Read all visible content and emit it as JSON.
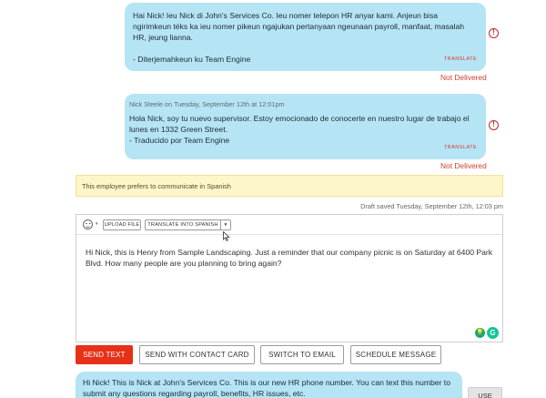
{
  "messages": [
    {
      "meta": "",
      "body": "Hai Nick! Ieu Nick di John's Services Co. Ieu nomer telepon HR anyar kami. Anjeun bisa ngirimkeun téks ka ieu nomer pikeun ngajukan pertanyaan ngeunaan payroll, manfaat, masalah HR, jeung lianna.",
      "footer": "- Diterjemahkeun ku Team Engine",
      "translate_label": "TRANSLATE",
      "status": "Not Delivered"
    },
    {
      "meta": "Nick Steele on Tuesday, September 12th at 12:01pm",
      "body": "Hola Nick, soy tu nuevo supervisor. Estoy emocionado de conocerte en nuestro lugar de trabajo el lunes en 1332 Green Street.",
      "footer": "- Traducido por Team Engine",
      "translate_label": "TRANSLATE",
      "status": "Not Delivered"
    }
  ],
  "alert_icon_name": "exclamation-circle-icon",
  "preference_banner": "This employee prefers to communicate in Spanish",
  "draft_status": "Draft saved Tuesday, September 12th, 12:03 pm",
  "composer": {
    "toolbar": {
      "emoji_icon": "emoji-smile-icon",
      "emoji_caret": "▾",
      "upload_label": "UPLOAD FILE",
      "translate_label": "TRANSLATE INTO SPANISH",
      "translate_caret": "▾"
    },
    "text": "Hi Nick, this is Henry from Sample Landscaping. Just a reminder that our company picnic is on Saturday at 6400 Park Blvd. How many people are you planning to bring again?",
    "grammarly_bulb": "💡",
    "grammarly_logo": "G"
  },
  "actions": {
    "send_text": "SEND TEXT",
    "send_contact_card": "SEND WITH CONTACT CARD",
    "switch_email": "SWITCH TO EMAIL",
    "schedule": "SCHEDULE MESSAGE"
  },
  "suggestion": {
    "text": "Hi Nick! This is Nick at John's Services Co. This is our new HR phone number. You can text this number to submit any questions regarding payroll, benefits, HR issues, etc.",
    "use_label": "USE"
  },
  "colors": {
    "bubble": "#b5e4f5",
    "accent_red": "#e63017",
    "banner": "#fdf6c8"
  }
}
